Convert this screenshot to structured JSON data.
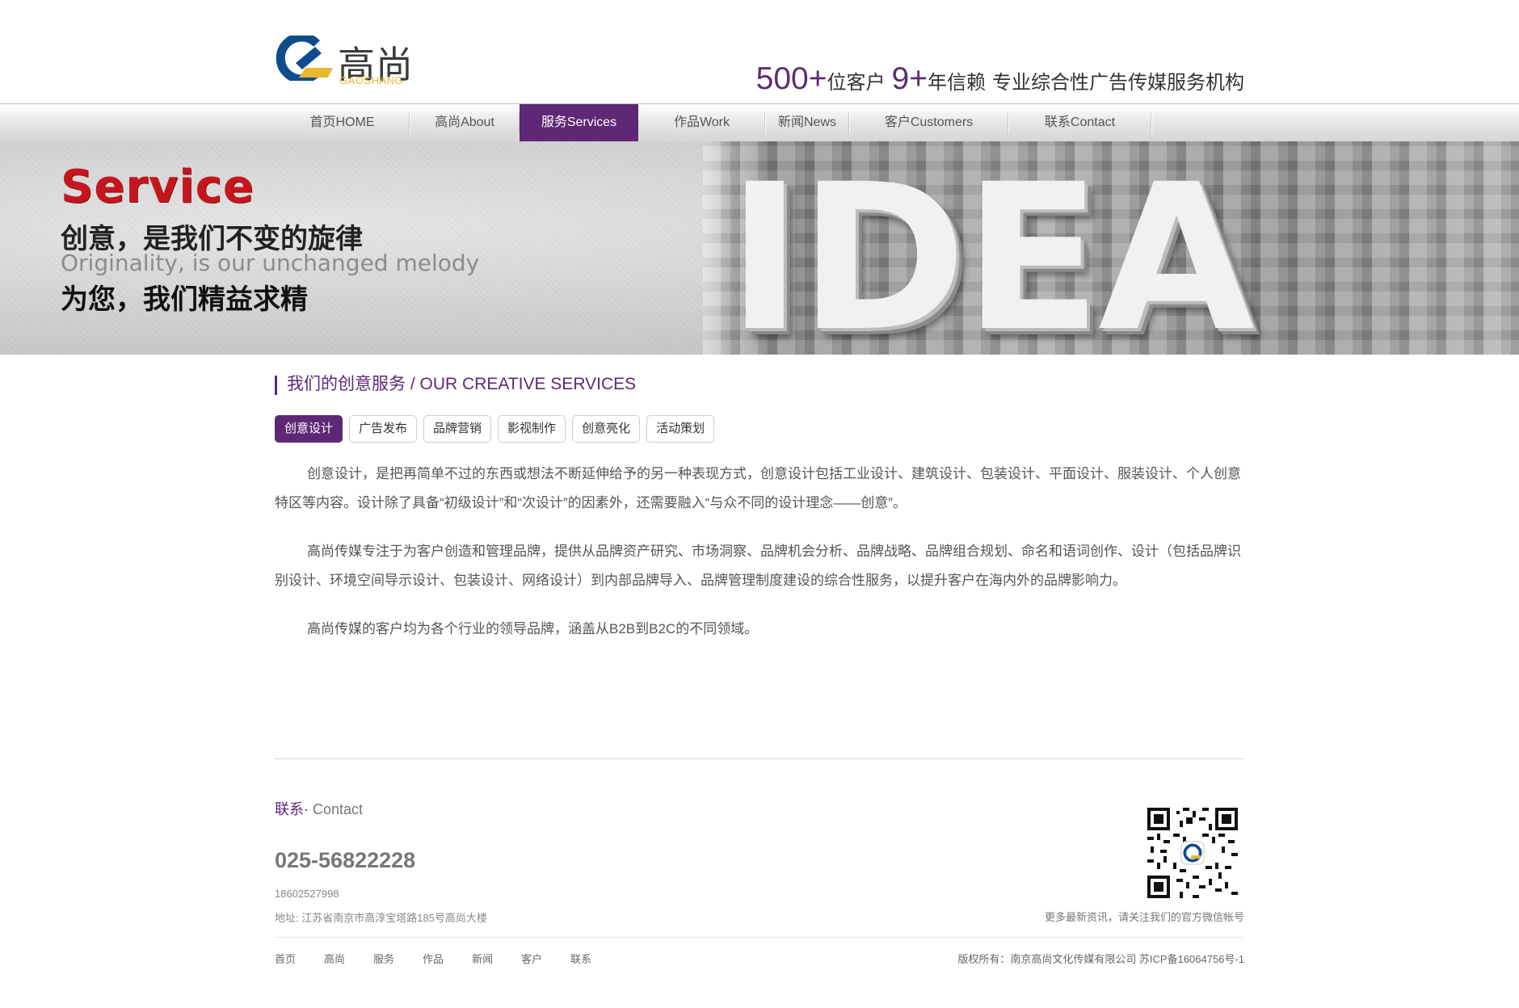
{
  "brand": {
    "logo_cn": "高尚",
    "logo_en": "GAOSHANG",
    "colors": {
      "primary": "#5e2876",
      "logo_blue": "#0f4c8c",
      "logo_yellow": "#e7b92d",
      "banner_red": "#c5161d"
    }
  },
  "tagline": {
    "num1": "500+",
    "text1": "位客户",
    "num2": "9+",
    "text2": "年信赖",
    "text3": "专业综合性广告传媒服务机构"
  },
  "nav": [
    {
      "label": "首页HOME",
      "active": false
    },
    {
      "label": "高尚About",
      "active": false
    },
    {
      "label": "服务Services",
      "active": true
    },
    {
      "label": "作品Work",
      "active": false
    },
    {
      "label": "新闻News",
      "active": false
    },
    {
      "label": "客户Customers",
      "active": false
    },
    {
      "label": "联系Contact",
      "active": false
    }
  ],
  "banner": {
    "title": "Service",
    "line1": "创意，是我们不变的旋律",
    "line2": "Originality, is our unchanged melody",
    "line3": "为您，我们精益求精",
    "big_word": "IDEA"
  },
  "section": {
    "title": "我们的创意服务 / OUR CREATIVE SERVICES"
  },
  "tabs": [
    {
      "label": "创意设计",
      "active": true
    },
    {
      "label": "广告发布",
      "active": false
    },
    {
      "label": "品牌营销",
      "active": false
    },
    {
      "label": "影视制作",
      "active": false
    },
    {
      "label": "创意亮化",
      "active": false
    },
    {
      "label": "活动策划",
      "active": false
    }
  ],
  "paragraphs": [
    "创意设计，是把再简单不过的东西或想法不断延伸给予的另一种表现方式，创意设计包括工业设计、建筑设计、包装设计、平面设计、服装设计、个人创意特区等内容。设计除了具备“初级设计”和“次设计”的因素外，还需要融入“与众不同的设计理念——创意”。",
    "高尚传媒专注于为客户创造和管理品牌，提供从品牌资产研究、市场洞察、品牌机会分析、品牌战略、品牌组合规划、命名和语词创作、设计（包括品牌识别设计、环境空间导示设计、包装设计、网络设计）到内部品牌导入、品牌管理制度建设的综合性服务，以提升客户在海内外的品牌影响力。",
    "高尚传媒的客户均为各个行业的领导品牌，涵盖从B2B到B2C的不同领域。"
  ],
  "footer": {
    "contact_cn": "联系·",
    "contact_en": " Contact",
    "phone": "025-56822228",
    "mobile": "18602527998",
    "address": "地址: 江苏省南京市高淳宝塔路185号高尚大楼",
    "qr_caption": "更多最新资讯，请关注我们的官方微信帐号",
    "links": [
      "首页",
      "高尚",
      "服务",
      "作品",
      "新闻",
      "客户",
      "联系"
    ],
    "copyright": "版权所有：南京高尚文化传媒有限公司   苏ICP备16064756号-1"
  }
}
